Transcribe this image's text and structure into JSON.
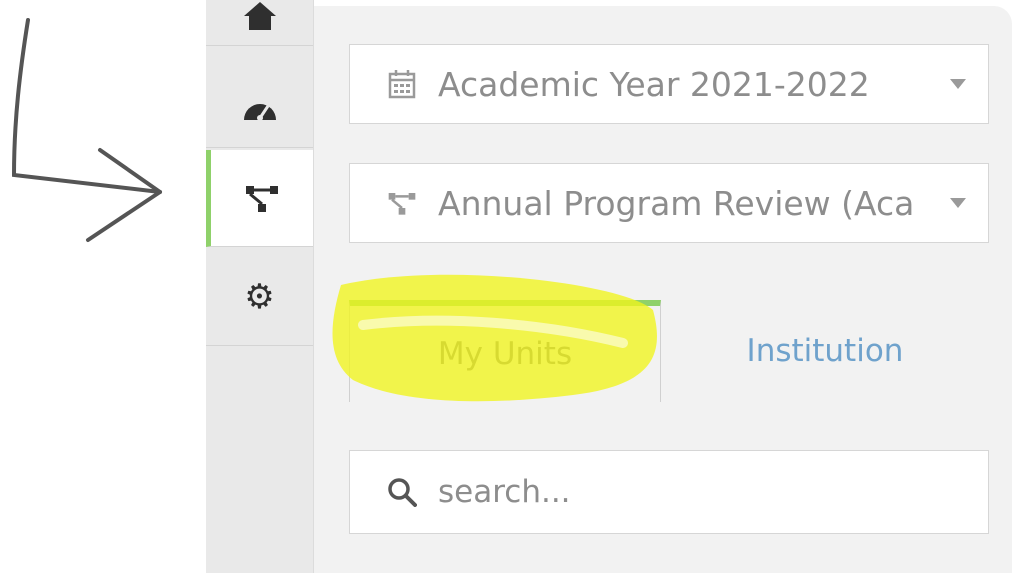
{
  "rail": {
    "items": [
      {
        "name": "home-icon"
      },
      {
        "name": "dashboard-icon"
      },
      {
        "name": "hierarchy-icon",
        "active": true
      },
      {
        "name": "gear-icon"
      }
    ]
  },
  "filters": {
    "year_label": "Academic Year 2021-2022",
    "review_label": "Annual Program Review (Aca"
  },
  "tabs": {
    "my_units": "My Units",
    "institution": "Institution"
  },
  "search": {
    "placeholder": "search..."
  },
  "colors": {
    "accent_green": "#8fd16a",
    "link_blue": "#6fa2cc",
    "highlight_yellow": "#f1f51c"
  }
}
